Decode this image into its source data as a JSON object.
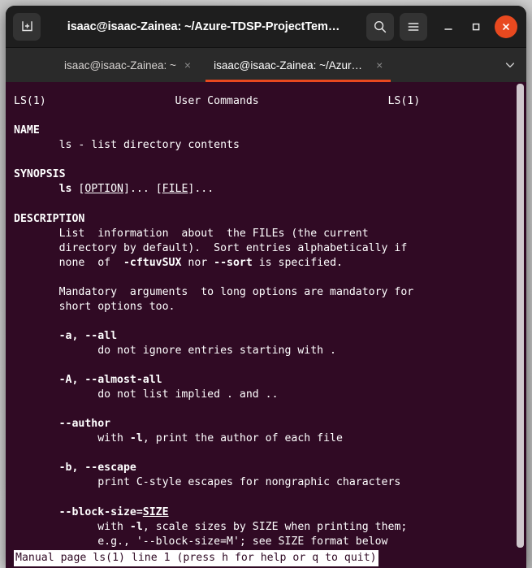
{
  "window": {
    "title": "isaac@isaac-Zainea: ~/Azure-TDSP-ProjectTem…",
    "new_tab_icon": "new-terminal-icon",
    "search_icon": "search-icon",
    "menu_icon": "hamburger-menu-icon",
    "minimize_label": "–",
    "maximize_label": "□",
    "close_label": "×",
    "accent_color": "#e8491f",
    "titlebar_color": "#1e1e1e",
    "terminal_bg": "#300a24"
  },
  "tabs": [
    {
      "label": "isaac@isaac-Zainea: ~",
      "close": "×",
      "active": false
    },
    {
      "label": "isaac@isaac-Zainea: ~/Azure-TD…",
      "close": "×",
      "active": true
    }
  ],
  "tab_dropdown_icon": "chevron-down-icon",
  "terminal": {
    "header_left": "LS(1)",
    "header_center": "User Commands",
    "header_right": "LS(1)",
    "sections": [
      {
        "heading": "NAME",
        "body": "ls - list directory contents"
      },
      {
        "heading": "SYNOPSIS",
        "body": "ls [OPTION]... [FILE]..."
      },
      {
        "heading": "DESCRIPTION",
        "body": "List  information  about  the FILEs (the current directory by default).  Sort entries alphabetically if none  of  -cftuvSUX nor --sort is specified."
      }
    ],
    "paragraph_mandatory": "Mandatory  arguments  to long options are mandatory for short options too.",
    "options": [
      {
        "flags": "-a, --all",
        "desc": "do not ignore entries starting with ."
      },
      {
        "flags": "-A, --almost-all",
        "desc": "do not list implied . and .."
      },
      {
        "flags": "--author",
        "desc": "with -l, print the author of each file"
      },
      {
        "flags": "-b, --escape",
        "desc": "print C-style escapes for nongraphic characters"
      },
      {
        "flags": "--block-size=SIZE",
        "desc": "with -l, scale sizes by SIZE when printing them; e.g., '--block-size=M'; see SIZE format below"
      }
    ],
    "status_line": "Manual page ls(1) line 1 (press h for help or q to quit)"
  }
}
